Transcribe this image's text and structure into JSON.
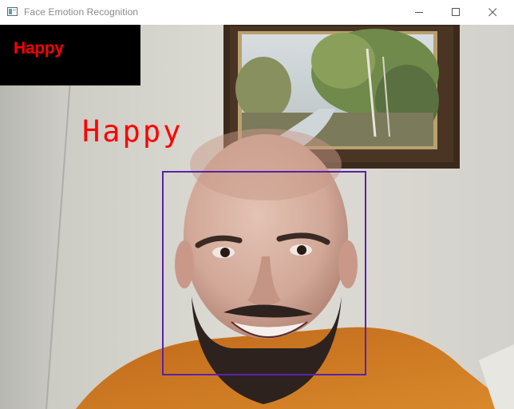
{
  "window": {
    "title": "Face Emotion Recognition",
    "icon": "app-window-icon",
    "controls": [
      "minimize-icon",
      "maximize-icon",
      "close-icon"
    ]
  },
  "overlay": {
    "status_text": "Happy",
    "face_label": "Happy",
    "label_color": "#ff0000",
    "box_color": "#5a22a8"
  }
}
